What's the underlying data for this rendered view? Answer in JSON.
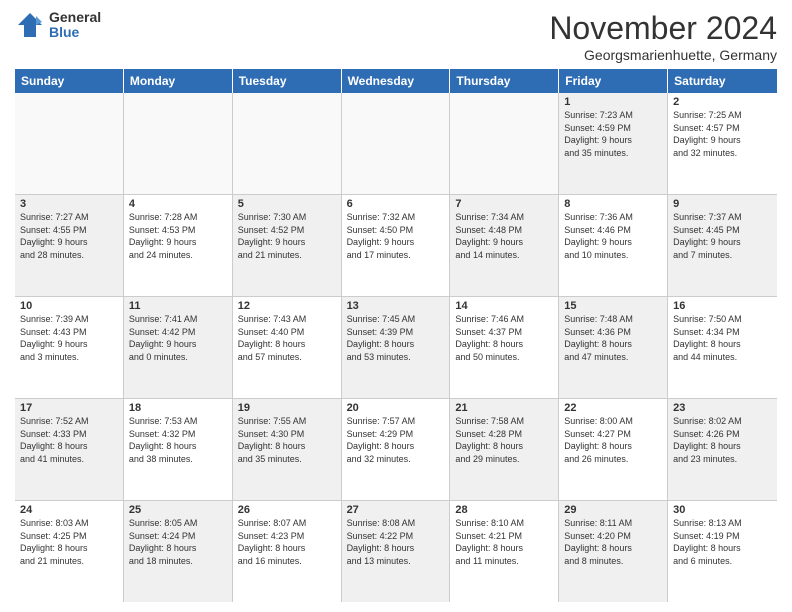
{
  "logo": {
    "general": "General",
    "blue": "Blue"
  },
  "title": "November 2024",
  "location": "Georgsmarienhuette, Germany",
  "header_days": [
    "Sunday",
    "Monday",
    "Tuesday",
    "Wednesday",
    "Thursday",
    "Friday",
    "Saturday"
  ],
  "rows": [
    [
      {
        "day": "",
        "detail": "",
        "empty": true
      },
      {
        "day": "",
        "detail": "",
        "empty": true
      },
      {
        "day": "",
        "detail": "",
        "empty": true
      },
      {
        "day": "",
        "detail": "",
        "empty": true
      },
      {
        "day": "",
        "detail": "",
        "empty": true
      },
      {
        "day": "1",
        "detail": "Sunrise: 7:23 AM\nSunset: 4:59 PM\nDaylight: 9 hours\nand 35 minutes.",
        "shaded": true
      },
      {
        "day": "2",
        "detail": "Sunrise: 7:25 AM\nSunset: 4:57 PM\nDaylight: 9 hours\nand 32 minutes.",
        "shaded": false
      }
    ],
    [
      {
        "day": "3",
        "detail": "Sunrise: 7:27 AM\nSunset: 4:55 PM\nDaylight: 9 hours\nand 28 minutes.",
        "shaded": true
      },
      {
        "day": "4",
        "detail": "Sunrise: 7:28 AM\nSunset: 4:53 PM\nDaylight: 9 hours\nand 24 minutes.",
        "shaded": false
      },
      {
        "day": "5",
        "detail": "Sunrise: 7:30 AM\nSunset: 4:52 PM\nDaylight: 9 hours\nand 21 minutes.",
        "shaded": true
      },
      {
        "day": "6",
        "detail": "Sunrise: 7:32 AM\nSunset: 4:50 PM\nDaylight: 9 hours\nand 17 minutes.",
        "shaded": false
      },
      {
        "day": "7",
        "detail": "Sunrise: 7:34 AM\nSunset: 4:48 PM\nDaylight: 9 hours\nand 14 minutes.",
        "shaded": true
      },
      {
        "day": "8",
        "detail": "Sunrise: 7:36 AM\nSunset: 4:46 PM\nDaylight: 9 hours\nand 10 minutes.",
        "shaded": false
      },
      {
        "day": "9",
        "detail": "Sunrise: 7:37 AM\nSunset: 4:45 PM\nDaylight: 9 hours\nand 7 minutes.",
        "shaded": true
      }
    ],
    [
      {
        "day": "10",
        "detail": "Sunrise: 7:39 AM\nSunset: 4:43 PM\nDaylight: 9 hours\nand 3 minutes.",
        "shaded": false
      },
      {
        "day": "11",
        "detail": "Sunrise: 7:41 AM\nSunset: 4:42 PM\nDaylight: 9 hours\nand 0 minutes.",
        "shaded": true
      },
      {
        "day": "12",
        "detail": "Sunrise: 7:43 AM\nSunset: 4:40 PM\nDaylight: 8 hours\nand 57 minutes.",
        "shaded": false
      },
      {
        "day": "13",
        "detail": "Sunrise: 7:45 AM\nSunset: 4:39 PM\nDaylight: 8 hours\nand 53 minutes.",
        "shaded": true
      },
      {
        "day": "14",
        "detail": "Sunrise: 7:46 AM\nSunset: 4:37 PM\nDaylight: 8 hours\nand 50 minutes.",
        "shaded": false
      },
      {
        "day": "15",
        "detail": "Sunrise: 7:48 AM\nSunset: 4:36 PM\nDaylight: 8 hours\nand 47 minutes.",
        "shaded": true
      },
      {
        "day": "16",
        "detail": "Sunrise: 7:50 AM\nSunset: 4:34 PM\nDaylight: 8 hours\nand 44 minutes.",
        "shaded": false
      }
    ],
    [
      {
        "day": "17",
        "detail": "Sunrise: 7:52 AM\nSunset: 4:33 PM\nDaylight: 8 hours\nand 41 minutes.",
        "shaded": true
      },
      {
        "day": "18",
        "detail": "Sunrise: 7:53 AM\nSunset: 4:32 PM\nDaylight: 8 hours\nand 38 minutes.",
        "shaded": false
      },
      {
        "day": "19",
        "detail": "Sunrise: 7:55 AM\nSunset: 4:30 PM\nDaylight: 8 hours\nand 35 minutes.",
        "shaded": true
      },
      {
        "day": "20",
        "detail": "Sunrise: 7:57 AM\nSunset: 4:29 PM\nDaylight: 8 hours\nand 32 minutes.",
        "shaded": false
      },
      {
        "day": "21",
        "detail": "Sunrise: 7:58 AM\nSunset: 4:28 PM\nDaylight: 8 hours\nand 29 minutes.",
        "shaded": true
      },
      {
        "day": "22",
        "detail": "Sunrise: 8:00 AM\nSunset: 4:27 PM\nDaylight: 8 hours\nand 26 minutes.",
        "shaded": false
      },
      {
        "day": "23",
        "detail": "Sunrise: 8:02 AM\nSunset: 4:26 PM\nDaylight: 8 hours\nand 23 minutes.",
        "shaded": true
      }
    ],
    [
      {
        "day": "24",
        "detail": "Sunrise: 8:03 AM\nSunset: 4:25 PM\nDaylight: 8 hours\nand 21 minutes.",
        "shaded": false
      },
      {
        "day": "25",
        "detail": "Sunrise: 8:05 AM\nSunset: 4:24 PM\nDaylight: 8 hours\nand 18 minutes.",
        "shaded": true
      },
      {
        "day": "26",
        "detail": "Sunrise: 8:07 AM\nSunset: 4:23 PM\nDaylight: 8 hours\nand 16 minutes.",
        "shaded": false
      },
      {
        "day": "27",
        "detail": "Sunrise: 8:08 AM\nSunset: 4:22 PM\nDaylight: 8 hours\nand 13 minutes.",
        "shaded": true
      },
      {
        "day": "28",
        "detail": "Sunrise: 8:10 AM\nSunset: 4:21 PM\nDaylight: 8 hours\nand 11 minutes.",
        "shaded": false
      },
      {
        "day": "29",
        "detail": "Sunrise: 8:11 AM\nSunset: 4:20 PM\nDaylight: 8 hours\nand 8 minutes.",
        "shaded": true
      },
      {
        "day": "30",
        "detail": "Sunrise: 8:13 AM\nSunset: 4:19 PM\nDaylight: 8 hours\nand 6 minutes.",
        "shaded": false
      }
    ]
  ]
}
